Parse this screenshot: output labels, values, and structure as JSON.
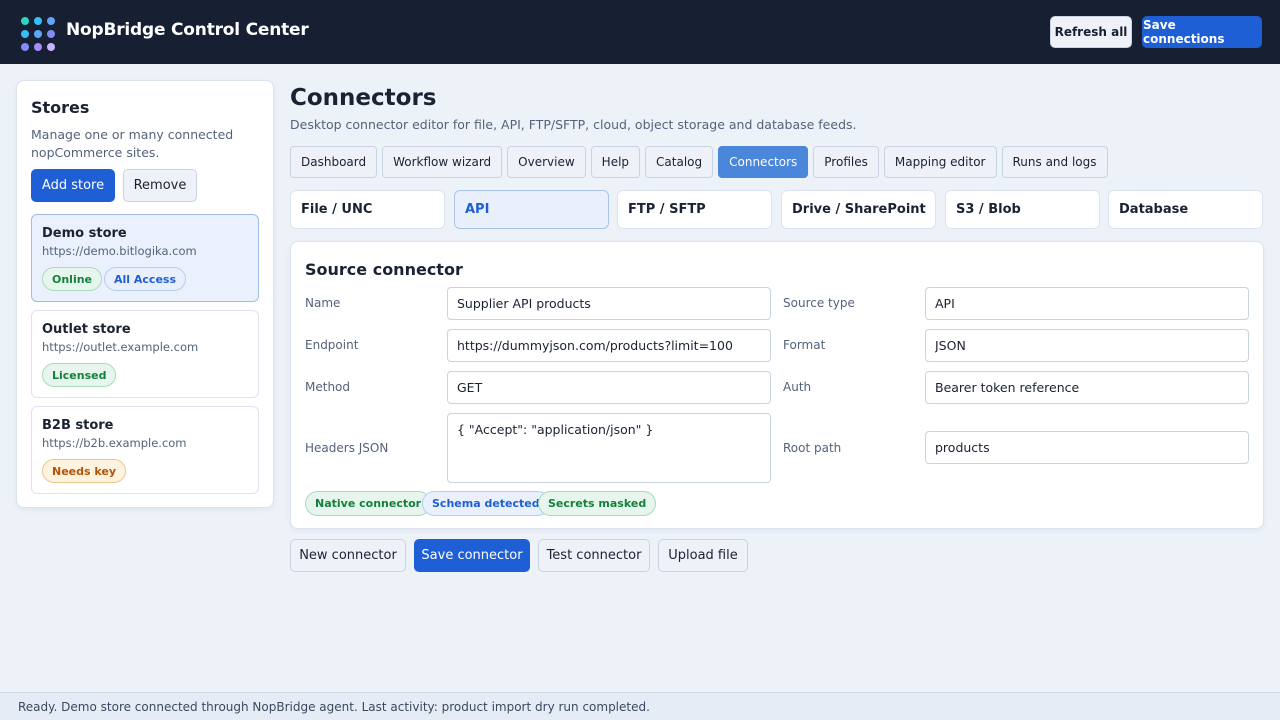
{
  "header": {
    "title": "NopBridge Control Center",
    "logo_icon": "dot-grid-logo-icon",
    "refresh_label": "Refresh all",
    "save_label": "Save connections"
  },
  "sidebar": {
    "title": "Stores",
    "description": "Manage one or many connected nopCommerce sites.",
    "add_label": "Add store",
    "remove_label": "Remove",
    "stores": [
      {
        "name": "Demo store",
        "url": "https://demo.bitlogika.com",
        "badges": [
          "Online",
          "All Access"
        ]
      },
      {
        "name": "Outlet store",
        "url": "https://outlet.example.com",
        "badges": [
          "Licensed"
        ]
      },
      {
        "name": "B2B store",
        "url": "https://b2b.example.com",
        "badges": [
          "Needs key"
        ]
      }
    ]
  },
  "main": {
    "title": "Connectors",
    "description": "Desktop connector editor for file, API, FTP/SFTP, cloud, object storage and database feeds.",
    "tabs": [
      "Dashboard",
      "Workflow wizard",
      "Overview",
      "Help",
      "Catalog",
      "Connectors",
      "Profiles",
      "Mapping editor",
      "Runs and logs"
    ],
    "active_tab": "Connectors",
    "connector_types": [
      "File / UNC",
      "API",
      "FTP / SFTP",
      "Drive / SharePoint",
      "S3 / Blob",
      "Database"
    ],
    "active_connector_type": "API"
  },
  "source_connector": {
    "title": "Source connector",
    "name_label": "Name",
    "name_value": "Supplier API products",
    "source_type_label": "Source type",
    "source_type_value": "API",
    "endpoint_label": "Endpoint",
    "endpoint_value": "https://dummyjson.com/products?limit=100",
    "format_label": "Format",
    "format_value": "JSON",
    "method_label": "Method",
    "method_value": "GET",
    "auth_label": "Auth",
    "auth_value": "Bearer token reference",
    "headers_label": "Headers JSON",
    "headers_value": "{ \"Accept\": \"application/json\" }",
    "root_path_label": "Root path",
    "root_path_value": "products",
    "badges": [
      "Native connector",
      "Schema detected",
      "Secrets masked"
    ]
  },
  "actions": {
    "new_label": "New connector",
    "save_label": "Save connector",
    "test_label": "Test connector",
    "upload_label": "Upload file"
  },
  "status": {
    "text": "Ready. Demo store connected through NopBridge agent. Last activity: product import dry run completed."
  },
  "colors": {
    "topbar": "#172033",
    "primary": "#1e5fd6",
    "active_tab": "#4a86d9",
    "success": "#15803d",
    "warning": "#b45309",
    "logo_dots": [
      "#2dd4bf",
      "#38bdf8",
      "#60a5fa",
      "#818cf8",
      "#a78bfa",
      "#c4b5fd"
    ]
  }
}
